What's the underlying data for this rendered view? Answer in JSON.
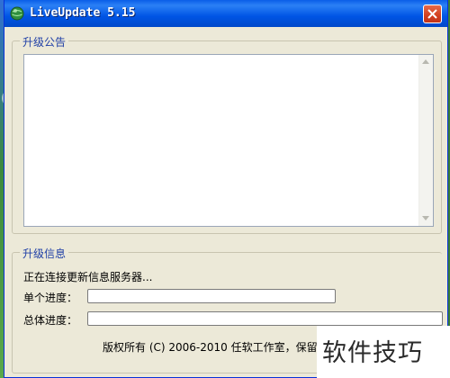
{
  "window": {
    "title": "LiveUpdate 5.15"
  },
  "notice_group": {
    "label": "升级公告",
    "content": ""
  },
  "info_group": {
    "label": "升级信息",
    "status": "正在连接更新信息服务器...",
    "single_progress_label": "单个进度：",
    "total_progress_label": "总体进度：",
    "single_progress_value": 0,
    "total_progress_value": 0,
    "copyright": "版权所有 (C) 2006-2010 任软工作室，保留所"
  },
  "watermark": {
    "text": "软件技巧"
  },
  "icons": {
    "app": "globe-icon",
    "close": "close-icon",
    "scroll_up": "triangle-up-icon",
    "scroll_down": "triangle-down-icon"
  },
  "colors": {
    "titlebar": "#0055e5",
    "window_bg": "#ece9d8",
    "group_label": "#1f3fa6",
    "close_button": "#d2401f"
  }
}
